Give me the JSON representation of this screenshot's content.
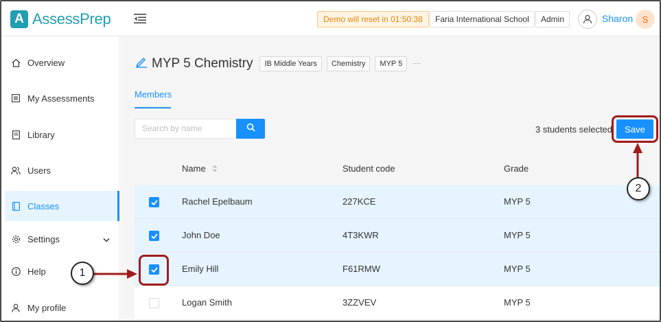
{
  "header": {
    "logo_letter": "A",
    "logo_text": "AssessPrep",
    "demo_reset": "Demo will reset in 01:50:38",
    "school": "Faria International School",
    "role": "Admin",
    "user_name": "Sharon",
    "avatar_initial": "S"
  },
  "sidebar": {
    "items": [
      {
        "label": "Overview",
        "icon": "home-icon"
      },
      {
        "label": "My Assessments",
        "icon": "list-icon"
      },
      {
        "label": "Library",
        "icon": "book-icon"
      },
      {
        "label": "Users",
        "icon": "users-icon"
      },
      {
        "label": "Classes",
        "icon": "classes-icon",
        "active": true
      },
      {
        "label": "Settings",
        "icon": "gear-icon",
        "expandable": true
      },
      {
        "label": "Help",
        "icon": "info-icon"
      },
      {
        "label": "My profile",
        "icon": "user-icon"
      }
    ]
  },
  "class": {
    "title": "MYP 5 Chemistry",
    "tags": [
      "IB Middle Years",
      "Chemistry",
      "MYP 5"
    ]
  },
  "tabs": {
    "members": "Members"
  },
  "search": {
    "placeholder": "Search by name"
  },
  "selection": {
    "text": "3 students selected",
    "save_label": "Save"
  },
  "table": {
    "headers": {
      "name": "Name",
      "code": "Student code",
      "grade": "Grade"
    },
    "rows": [
      {
        "name": "Rachel Epelbaum",
        "code": "227KCE",
        "grade": "MYP 5",
        "selected": true
      },
      {
        "name": "John Doe",
        "code": "4T3KWR",
        "grade": "MYP 5",
        "selected": true
      },
      {
        "name": "Emily Hill",
        "code": "F61RMW",
        "grade": "MYP 5",
        "selected": true
      },
      {
        "name": "Logan Smith",
        "code": "3ZZVEV",
        "grade": "MYP 5",
        "selected": false
      }
    ]
  },
  "callouts": {
    "one": "1",
    "two": "2"
  },
  "colors": {
    "accent": "#1890ff",
    "brand": "#1f9fb0",
    "annotation": "#a11b1b",
    "demo": "#e8860c"
  }
}
